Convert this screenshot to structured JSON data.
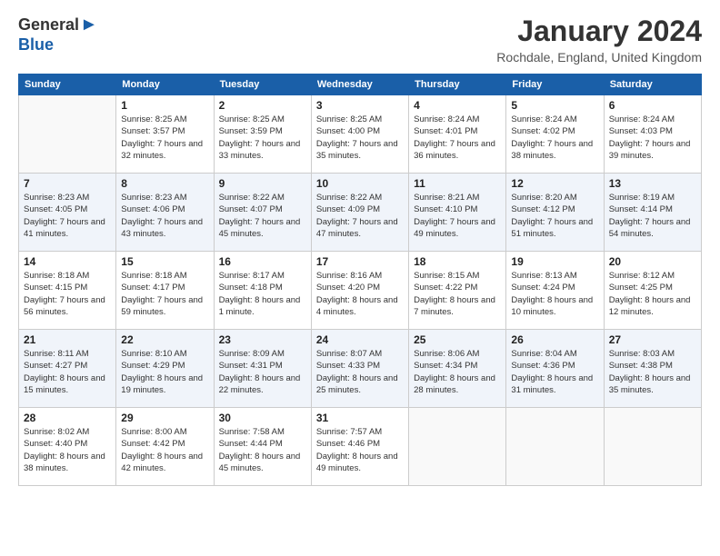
{
  "logo": {
    "general": "General",
    "blue": "Blue",
    "arrow": "▶"
  },
  "title": "January 2024",
  "subtitle": "Rochdale, England, United Kingdom",
  "days_header": [
    "Sunday",
    "Monday",
    "Tuesday",
    "Wednesday",
    "Thursday",
    "Friday",
    "Saturday"
  ],
  "weeks": [
    [
      {
        "day": "",
        "sunrise": "",
        "sunset": "",
        "daylight": ""
      },
      {
        "day": "1",
        "sunrise": "Sunrise: 8:25 AM",
        "sunset": "Sunset: 3:57 PM",
        "daylight": "Daylight: 7 hours and 32 minutes."
      },
      {
        "day": "2",
        "sunrise": "Sunrise: 8:25 AM",
        "sunset": "Sunset: 3:59 PM",
        "daylight": "Daylight: 7 hours and 33 minutes."
      },
      {
        "day": "3",
        "sunrise": "Sunrise: 8:25 AM",
        "sunset": "Sunset: 4:00 PM",
        "daylight": "Daylight: 7 hours and 35 minutes."
      },
      {
        "day": "4",
        "sunrise": "Sunrise: 8:24 AM",
        "sunset": "Sunset: 4:01 PM",
        "daylight": "Daylight: 7 hours and 36 minutes."
      },
      {
        "day": "5",
        "sunrise": "Sunrise: 8:24 AM",
        "sunset": "Sunset: 4:02 PM",
        "daylight": "Daylight: 7 hours and 38 minutes."
      },
      {
        "day": "6",
        "sunrise": "Sunrise: 8:24 AM",
        "sunset": "Sunset: 4:03 PM",
        "daylight": "Daylight: 7 hours and 39 minutes."
      }
    ],
    [
      {
        "day": "7",
        "sunrise": "Sunrise: 8:23 AM",
        "sunset": "Sunset: 4:05 PM",
        "daylight": "Daylight: 7 hours and 41 minutes."
      },
      {
        "day": "8",
        "sunrise": "Sunrise: 8:23 AM",
        "sunset": "Sunset: 4:06 PM",
        "daylight": "Daylight: 7 hours and 43 minutes."
      },
      {
        "day": "9",
        "sunrise": "Sunrise: 8:22 AM",
        "sunset": "Sunset: 4:07 PM",
        "daylight": "Daylight: 7 hours and 45 minutes."
      },
      {
        "day": "10",
        "sunrise": "Sunrise: 8:22 AM",
        "sunset": "Sunset: 4:09 PM",
        "daylight": "Daylight: 7 hours and 47 minutes."
      },
      {
        "day": "11",
        "sunrise": "Sunrise: 8:21 AM",
        "sunset": "Sunset: 4:10 PM",
        "daylight": "Daylight: 7 hours and 49 minutes."
      },
      {
        "day": "12",
        "sunrise": "Sunrise: 8:20 AM",
        "sunset": "Sunset: 4:12 PM",
        "daylight": "Daylight: 7 hours and 51 minutes."
      },
      {
        "day": "13",
        "sunrise": "Sunrise: 8:19 AM",
        "sunset": "Sunset: 4:14 PM",
        "daylight": "Daylight: 7 hours and 54 minutes."
      }
    ],
    [
      {
        "day": "14",
        "sunrise": "Sunrise: 8:18 AM",
        "sunset": "Sunset: 4:15 PM",
        "daylight": "Daylight: 7 hours and 56 minutes."
      },
      {
        "day": "15",
        "sunrise": "Sunrise: 8:18 AM",
        "sunset": "Sunset: 4:17 PM",
        "daylight": "Daylight: 7 hours and 59 minutes."
      },
      {
        "day": "16",
        "sunrise": "Sunrise: 8:17 AM",
        "sunset": "Sunset: 4:18 PM",
        "daylight": "Daylight: 8 hours and 1 minute."
      },
      {
        "day": "17",
        "sunrise": "Sunrise: 8:16 AM",
        "sunset": "Sunset: 4:20 PM",
        "daylight": "Daylight: 8 hours and 4 minutes."
      },
      {
        "day": "18",
        "sunrise": "Sunrise: 8:15 AM",
        "sunset": "Sunset: 4:22 PM",
        "daylight": "Daylight: 8 hours and 7 minutes."
      },
      {
        "day": "19",
        "sunrise": "Sunrise: 8:13 AM",
        "sunset": "Sunset: 4:24 PM",
        "daylight": "Daylight: 8 hours and 10 minutes."
      },
      {
        "day": "20",
        "sunrise": "Sunrise: 8:12 AM",
        "sunset": "Sunset: 4:25 PM",
        "daylight": "Daylight: 8 hours and 12 minutes."
      }
    ],
    [
      {
        "day": "21",
        "sunrise": "Sunrise: 8:11 AM",
        "sunset": "Sunset: 4:27 PM",
        "daylight": "Daylight: 8 hours and 15 minutes."
      },
      {
        "day": "22",
        "sunrise": "Sunrise: 8:10 AM",
        "sunset": "Sunset: 4:29 PM",
        "daylight": "Daylight: 8 hours and 19 minutes."
      },
      {
        "day": "23",
        "sunrise": "Sunrise: 8:09 AM",
        "sunset": "Sunset: 4:31 PM",
        "daylight": "Daylight: 8 hours and 22 minutes."
      },
      {
        "day": "24",
        "sunrise": "Sunrise: 8:07 AM",
        "sunset": "Sunset: 4:33 PM",
        "daylight": "Daylight: 8 hours and 25 minutes."
      },
      {
        "day": "25",
        "sunrise": "Sunrise: 8:06 AM",
        "sunset": "Sunset: 4:34 PM",
        "daylight": "Daylight: 8 hours and 28 minutes."
      },
      {
        "day": "26",
        "sunrise": "Sunrise: 8:04 AM",
        "sunset": "Sunset: 4:36 PM",
        "daylight": "Daylight: 8 hours and 31 minutes."
      },
      {
        "day": "27",
        "sunrise": "Sunrise: 8:03 AM",
        "sunset": "Sunset: 4:38 PM",
        "daylight": "Daylight: 8 hours and 35 minutes."
      }
    ],
    [
      {
        "day": "28",
        "sunrise": "Sunrise: 8:02 AM",
        "sunset": "Sunset: 4:40 PM",
        "daylight": "Daylight: 8 hours and 38 minutes."
      },
      {
        "day": "29",
        "sunrise": "Sunrise: 8:00 AM",
        "sunset": "Sunset: 4:42 PM",
        "daylight": "Daylight: 8 hours and 42 minutes."
      },
      {
        "day": "30",
        "sunrise": "Sunrise: 7:58 AM",
        "sunset": "Sunset: 4:44 PM",
        "daylight": "Daylight: 8 hours and 45 minutes."
      },
      {
        "day": "31",
        "sunrise": "Sunrise: 7:57 AM",
        "sunset": "Sunset: 4:46 PM",
        "daylight": "Daylight: 8 hours and 49 minutes."
      },
      {
        "day": "",
        "sunrise": "",
        "sunset": "",
        "daylight": ""
      },
      {
        "day": "",
        "sunrise": "",
        "sunset": "",
        "daylight": ""
      },
      {
        "day": "",
        "sunrise": "",
        "sunset": "",
        "daylight": ""
      }
    ]
  ]
}
